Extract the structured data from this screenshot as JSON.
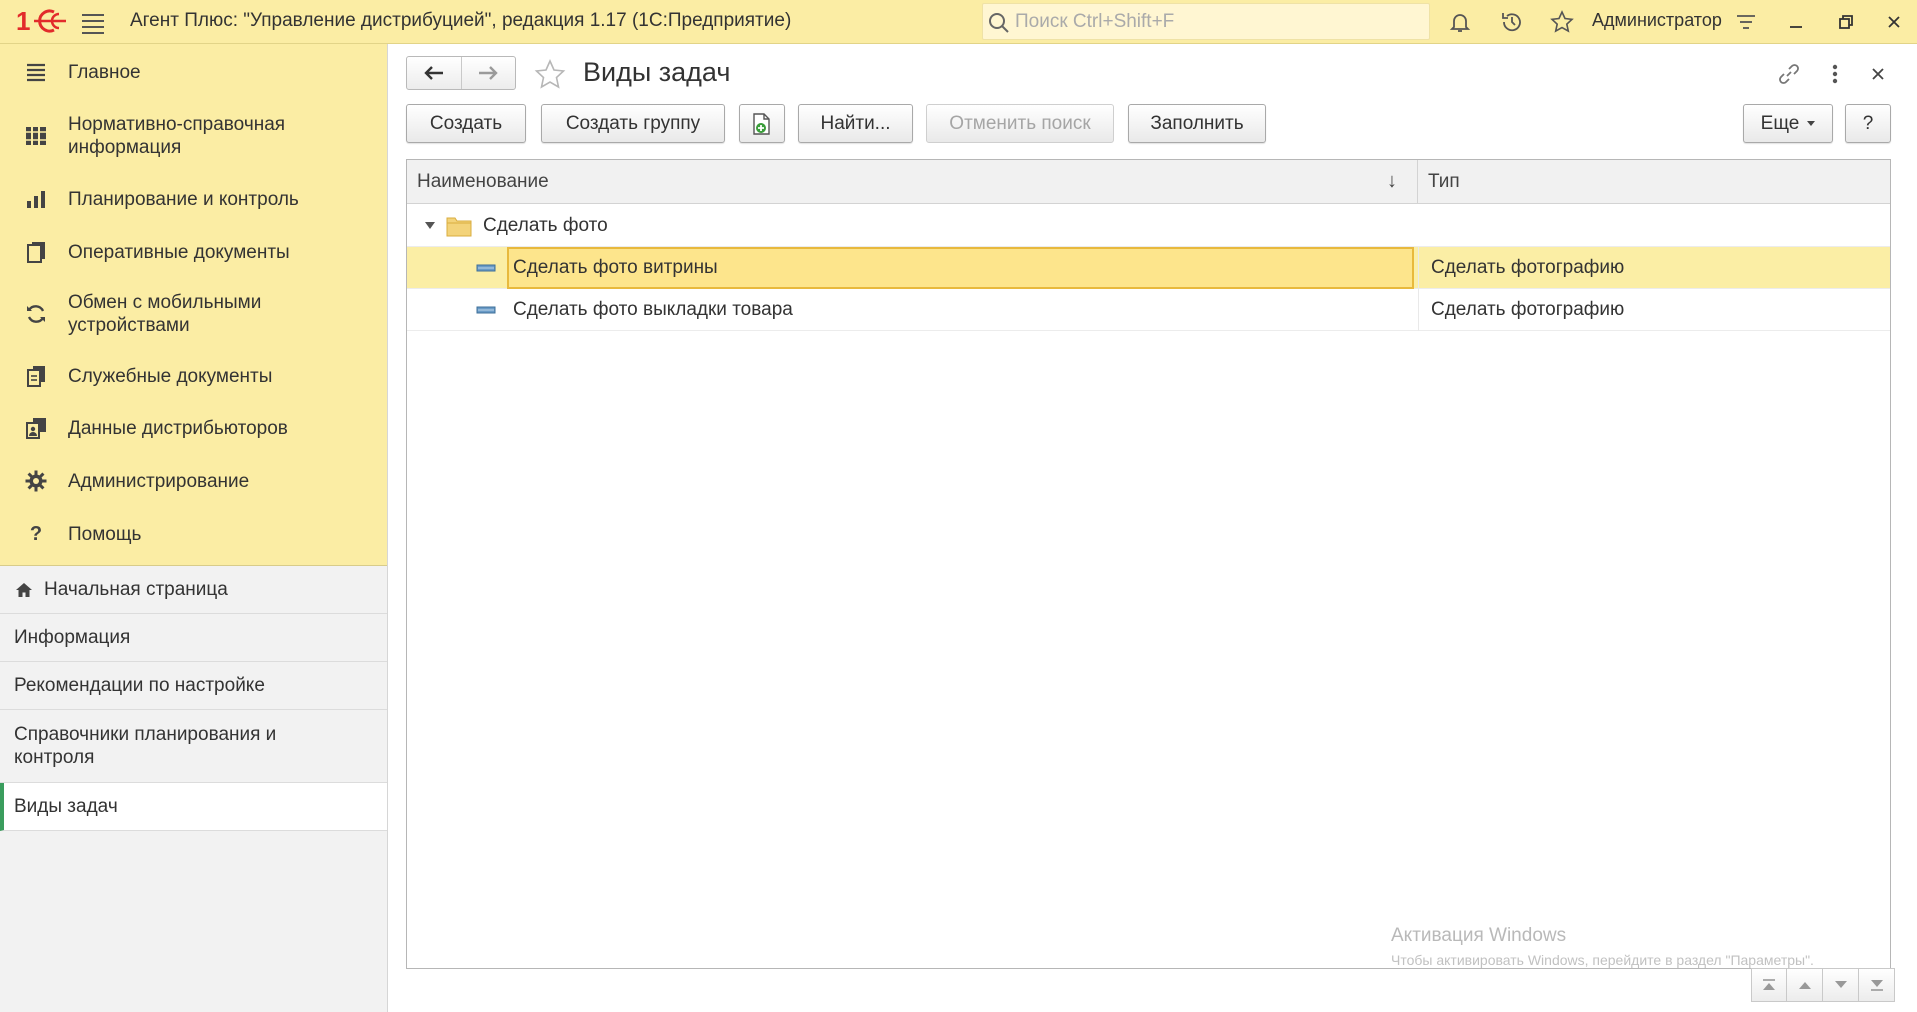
{
  "titlebar": {
    "logo": "1С",
    "app_title": "Агент Плюс: \"Управление дистрибуцией\", редакция 1.17  (1С:Предприятие)",
    "search_placeholder": "Поиск Ctrl+Shift+F",
    "user": "Администратор",
    "icons": [
      "bell-icon",
      "history-icon",
      "star-icon",
      "settings-icon",
      "minimize-icon",
      "restore-icon",
      "close-icon"
    ]
  },
  "sidebar": {
    "sections": [
      {
        "label": "Главное",
        "icon": "menu-lines-icon"
      },
      {
        "label": "Нормативно-справочная информация",
        "icon": "reference-books-icon"
      },
      {
        "label": "Планирование и контроль",
        "icon": "bar-chart-icon"
      },
      {
        "label": "Оперативные документы",
        "icon": "documents-icon"
      },
      {
        "label": "Обмен с мобильными устройствами",
        "icon": "sync-icon"
      },
      {
        "label": "Служебные документы",
        "icon": "service-docs-icon"
      },
      {
        "label": "Данные дистрибьюторов",
        "icon": "distributor-data-icon"
      },
      {
        "label": "Администрирование",
        "icon": "gear-icon"
      },
      {
        "label": "Помощь",
        "icon": "question-icon"
      }
    ],
    "open_windows": [
      {
        "label": "Начальная страница",
        "icon": "home-icon"
      },
      {
        "label": "Информация"
      },
      {
        "label": "Рекомендации по настройке"
      },
      {
        "label": "Справочники планирования и контроля"
      },
      {
        "label": "Виды задач",
        "active": true
      }
    ]
  },
  "form": {
    "title": "Виды задач",
    "toolbar": {
      "create": "Создать",
      "create_group": "Создать группу",
      "find": "Найти...",
      "cancel_search": "Отменить поиск",
      "fill": "Заполнить",
      "more": "Еще",
      "help": "?"
    },
    "table": {
      "columns": [
        "Наименование",
        "Тип"
      ],
      "sort_indicator": "↓",
      "rows": [
        {
          "kind": "group",
          "name": "Сделать фото",
          "type": "",
          "expanded": true
        },
        {
          "kind": "item",
          "name": "Сделать фото витрины",
          "type": "Сделать фотографию",
          "selected": true
        },
        {
          "kind": "item",
          "name": "Сделать фото выкладки товара",
          "type": "Сделать фотографию"
        }
      ]
    }
  },
  "watermark": {
    "title": "Активация Windows",
    "subtitle": "Чтобы активировать Windows, перейдите в раздел \"Параметры\"."
  },
  "colors": {
    "accent_yellow": "#fbeda4",
    "selection": "#fde58c",
    "focus_border": "#e8b93d",
    "logo_red": "#e22b2b",
    "active_marker": "#3a9d5d"
  }
}
